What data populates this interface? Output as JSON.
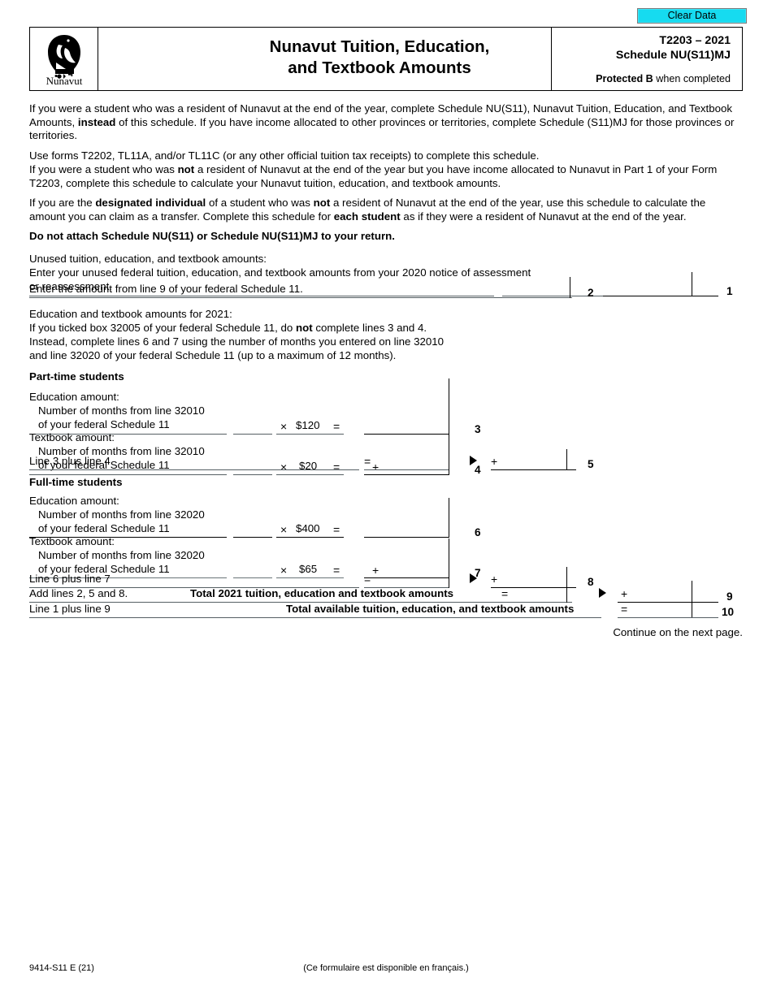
{
  "toolbar": {
    "clear_data_label": "Clear Data",
    "clear_data_color": "#16dbf0"
  },
  "header": {
    "logo_name": "Nunavut",
    "title_line1": "Nunavut Tuition, Education,",
    "title_line2": "and Textbook Amounts",
    "form_code": "T2203 – 2021",
    "schedule_code": "Schedule NU(S11)MJ",
    "protected_bold": "Protected B",
    "protected_rest": " when completed"
  },
  "intro": {
    "p1_a": "If you were a student who was a resident of Nunavut at the end of the year, complete Schedule NU(S11), Nunavut Tuition, Education, and Textbook Amounts, ",
    "p1_b": "instead",
    "p1_c": " of this schedule. If you have income allocated to other provinces or territories, complete Schedule (S11)MJ for those provinces or territories.",
    "p2_a": "Use forms T2202, TL11A, and/or TL11C (or any other official tuition tax receipts) to complete this schedule.",
    "p2_b": "If you were a student who was ",
    "p2_bold": "not",
    "p2_c": " a resident of Nunavut at the end of the year but you have income allocated to Nunavut in Part 1 of your Form T2203, complete this schedule to calculate your Nunavut tuition, education, and textbook amounts.",
    "p3_a": "If you are the ",
    "p3_b1": "designated individual",
    "p3_c": " of a student who was ",
    "p3_b2": "not",
    "p3_d": " a resident of Nunavut at the end of the year, use this schedule to calculate the amount you can claim as a transfer. Complete this schedule for ",
    "p3_b3": "each student",
    "p3_e": " as if they were a resident of Nunavut at the end of the year.",
    "p4_bold": "Do not attach Schedule NU(S11) or Schedule NU(S11)MJ to your return."
  },
  "unused": {
    "heading": "Unused tuition, education, and textbook amounts:",
    "line1_text_a": "Enter your unused federal tuition, education, and textbook amounts from your 2020 notice of assessment",
    "line1_text_b": "or reassessment.",
    "line1_number": "1",
    "line1_value": "",
    "line2_text": "Enter the amount from line 9 of your federal Schedule 11.",
    "line2_number": "2",
    "line2_value": ""
  },
  "education2021": {
    "heading": "Education and textbook amounts for 2021:",
    "p_a": "If you ticked box 32005 of your federal Schedule 11, do ",
    "p_bold": "not",
    "p_c": " complete lines 3 and 4.",
    "p_d": "Instead, complete lines 6 and 7 using the number of months you entered on line 32010",
    "p_e": "and line 32020 of your federal Schedule 11 (up to a maximum of 12 months)."
  },
  "parttime": {
    "heading": "Part-time students",
    "education_label": "Education amount:",
    "education_sub1": "Number of months from line 32010",
    "education_sub2": "of your federal Schedule 11",
    "education_months_value": "",
    "education_mult_sym": "×",
    "education_rate": "$120",
    "education_eq_sym": "=",
    "education_result_value": "",
    "line3_number": "3",
    "textbook_label": "Textbook amount:",
    "textbook_sub1": "Number of months from line 32010",
    "textbook_sub2": "of your federal Schedule 11",
    "textbook_months_value": "",
    "textbook_mult_sym": "×",
    "textbook_rate": "$20",
    "textbook_eq_sym": "=",
    "textbook_plus_sym": "+",
    "textbook_result_value": "",
    "line4_number": "4",
    "sum_label": "Line 3 plus line 4",
    "sum_eq_sym": "=",
    "sum_value": "",
    "sum_plus_sym": "+",
    "sum_carry_value": "",
    "line5_number": "5"
  },
  "fulltime": {
    "heading": "Full-time students",
    "education_label": "Education amount:",
    "education_sub1": "Number of months from line 32020",
    "education_sub2": "of your federal Schedule 11",
    "education_months_value": "",
    "education_mult_sym": "×",
    "education_rate": "$400",
    "education_eq_sym": "=",
    "education_result_value": "",
    "line6_number": "6",
    "textbook_label": "Textbook amount:",
    "textbook_sub1": "Number of months from line 32020",
    "textbook_sub2": "of your federal Schedule 11",
    "textbook_months_value": "",
    "textbook_mult_sym": "×",
    "textbook_rate": "$65",
    "textbook_eq_sym": "=",
    "textbook_plus_sym": "+",
    "textbook_result_value": "",
    "line7_number": "7",
    "sum_label": "Line 6 plus line 7",
    "sum_eq_sym": "=",
    "sum_value": "",
    "sum_plus_sym": "+",
    "sum_carry_value": "",
    "line8_number": "8"
  },
  "totals": {
    "line9_label": "Add lines 2, 5 and 8.",
    "line9_title": "Total 2021 tuition, education and textbook amounts",
    "line9_eq_sym": "=",
    "line9_value": "",
    "line9_plus_sym": "+",
    "line9_carry_value": "",
    "line9_number": "9",
    "line10_label": "Line 1 plus line 9",
    "line10_title": "Total available tuition, education, and textbook amounts",
    "line10_eq_sym": "=",
    "line10_value": "",
    "line10_number": "10"
  },
  "footer": {
    "continue_text": "Continue on the next page.",
    "form_id": "9414-S11 E (21)",
    "french_note": "(Ce formulaire est disponible en français.)"
  }
}
